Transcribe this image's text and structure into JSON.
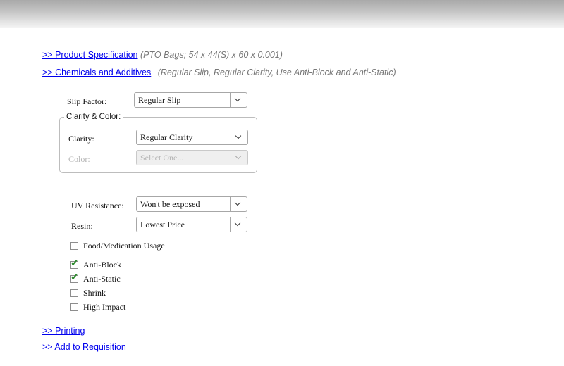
{
  "nav": {
    "product_spec_link": ">> Product Specification",
    "product_spec_note": "(PTO Bags; 54 x 44(S) x 60 x 0.001)",
    "chemicals_link": ">> Chemicals and Additives",
    "chemicals_note": "(Regular Slip, Regular Clarity, Use Anti-Block and Anti-Static)",
    "printing_link": ">> Printing",
    "requisition_link": ">> Add to Requisition"
  },
  "form": {
    "slip_factor": {
      "label": "Slip Factor:",
      "value": "Regular Slip"
    },
    "clarity_color": {
      "legend": "Clarity & Color:",
      "clarity": {
        "label": "Clarity:",
        "value": "Regular Clarity"
      },
      "color": {
        "label": "Color:",
        "placeholder": "Select One..."
      }
    },
    "uv_resistance": {
      "label": "UV Resistance:",
      "value": "Won't be exposed"
    },
    "resin": {
      "label": "Resin:",
      "value": "Lowest Price"
    },
    "checkboxes": [
      {
        "label": "Food/Medication Usage",
        "checked": false
      },
      {
        "label": "Anti-Block",
        "checked": true
      },
      {
        "label": "Anti-Static",
        "checked": true
      },
      {
        "label": "Shrink",
        "checked": false
      },
      {
        "label": "High Impact",
        "checked": false
      }
    ]
  },
  "colors": {
    "link": "#0000ee",
    "check": "#2e8b2e",
    "note": "#777777"
  }
}
